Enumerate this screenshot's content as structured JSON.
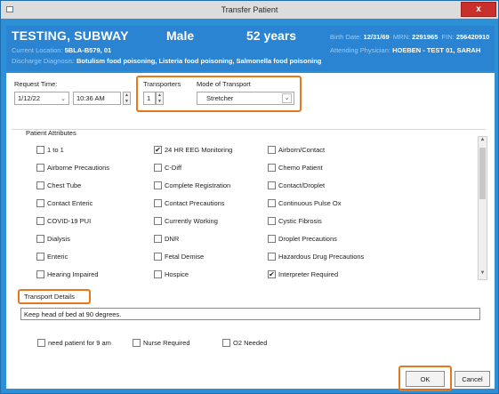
{
  "window": {
    "title": "Transfer Patient",
    "close_label": "x"
  },
  "banner": {
    "name": "TESTING, SUBWAY",
    "sex": "Male",
    "age": "52 years",
    "birth_date_label": "Birth Date:",
    "birth_date": "12/31/69",
    "mrn_label": "MRN:",
    "mrn": "2291965",
    "fin_label": "FIN:",
    "fin": "256420910",
    "location_label": "Current Location:",
    "location": "5BLA-B579, 01",
    "physician_label": "Attending Physician:",
    "physician": "HOEBEN - TEST 01, SARAH",
    "diagnosis_label": "Discharge Diagnosis:",
    "diagnosis": "Botulism food poisoning, Listeria food poisoning, Salmonella food poisoning"
  },
  "request": {
    "label": "Request Time:",
    "date": "1/12/22",
    "time": "10:36 AM"
  },
  "transporters": {
    "label": "Transporters",
    "value": "1"
  },
  "mode": {
    "label": "Mode of Transport",
    "value": "Stretcher"
  },
  "attributes": {
    "label": "Patient Attributes",
    "col1": [
      {
        "label": "1 to 1",
        "checked": false
      },
      {
        "label": "Airborne Precautions",
        "checked": false
      },
      {
        "label": "Chest Tube",
        "checked": false
      },
      {
        "label": "Contact Enteric",
        "checked": false
      },
      {
        "label": "COVID-19 PUI",
        "checked": false
      },
      {
        "label": "Dialysis",
        "checked": false
      },
      {
        "label": "Enteric",
        "checked": false
      },
      {
        "label": "Hearing Impaired",
        "checked": false
      }
    ],
    "col2": [
      {
        "label": "24 HR EEG Monitoring",
        "checked": true
      },
      {
        "label": "C-Diff",
        "checked": false
      },
      {
        "label": "Complete Registration",
        "checked": false
      },
      {
        "label": "Contact Precautions",
        "checked": false
      },
      {
        "label": "Currently Working",
        "checked": false
      },
      {
        "label": "DNR",
        "checked": false
      },
      {
        "label": "Fetal Demise",
        "checked": false
      },
      {
        "label": "Hospice",
        "checked": false
      }
    ],
    "col3": [
      {
        "label": "Airborn/Contact",
        "checked": false
      },
      {
        "label": "Chemo Patient",
        "checked": false
      },
      {
        "label": "Contact/Droplet",
        "checked": false
      },
      {
        "label": "Continuous Pulse Ox",
        "checked": false
      },
      {
        "label": "Cystic Fibrosis",
        "checked": false
      },
      {
        "label": "Droplet Precautions",
        "checked": false
      },
      {
        "label": "Hazardous Drug Precautions",
        "checked": false
      },
      {
        "label": "Interpreter Required",
        "checked": true
      }
    ]
  },
  "details": {
    "label": "Transport Details",
    "text": "Keep head of bed at 90 degrees."
  },
  "options": [
    {
      "label": "need patient for 9 am",
      "checked": false
    },
    {
      "label": "Nurse Required",
      "checked": false
    },
    {
      "label": "O2 Needed",
      "checked": false
    }
  ],
  "buttons": {
    "ok": "OK",
    "cancel": "Cancel"
  },
  "colors": {
    "banner": "#2a84d2",
    "frame": "#2d8fd6",
    "highlight": "#e8781e",
    "close": "#c9302c"
  }
}
